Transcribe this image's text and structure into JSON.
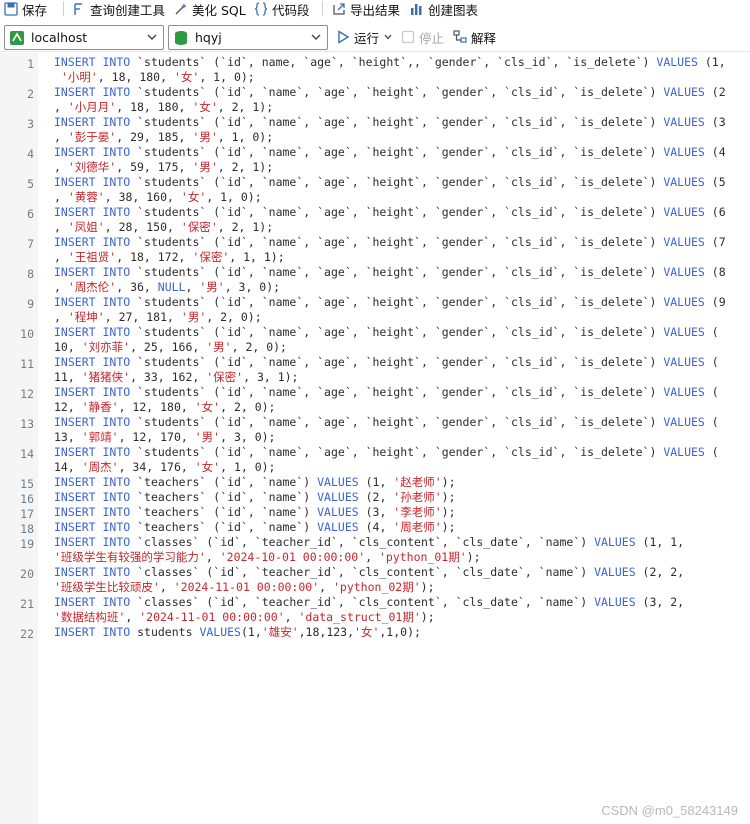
{
  "toolbar": {
    "save_label": "保存",
    "query_builder_label": "查询创建工具",
    "beautify_label": "美化 SQL",
    "snippet_label": "代码段",
    "export_label": "导出结果",
    "chart_label": "创建图表"
  },
  "connection": {
    "value": "localhost"
  },
  "database": {
    "value": "hqyj"
  },
  "actions": {
    "run_label": "运行",
    "stop_label": "停止",
    "explain_label": "解释"
  },
  "editor": {
    "lines": [
      {
        "n": "1",
        "a": "INSERT INTO `students` (`id`, name, `age`, `height`,, `gender`, `cls_id`, `is_delete`) VALUES (1,",
        "b": " '小明', 18, 180, '女', 1, 0);"
      },
      {
        "n": "2",
        "a": "INSERT INTO `students` (`id`, `name`, `age`, `height`, `gender`, `cls_id`, `is_delete`) VALUES (2",
        "b": ", '小月月', 18, 180, '女', 2, 1);"
      },
      {
        "n": "3",
        "a": "INSERT INTO `students` (`id`, `name`, `age`, `height`, `gender`, `cls_id`, `is_delete`) VALUES (3",
        "b": ", '彭于晏', 29, 185, '男', 1, 0);"
      },
      {
        "n": "4",
        "a": "INSERT INTO `students` (`id`, `name`, `age`, `height`, `gender`, `cls_id`, `is_delete`) VALUES (4",
        "b": ", '刘德华', 59, 175, '男', 2, 1);"
      },
      {
        "n": "5",
        "a": "INSERT INTO `students` (`id`, `name`, `age`, `height`, `gender`, `cls_id`, `is_delete`) VALUES (5",
        "b": ", '黄蓉', 38, 160, '女', 1, 0);"
      },
      {
        "n": "6",
        "a": "INSERT INTO `students` (`id`, `name`, `age`, `height`, `gender`, `cls_id`, `is_delete`) VALUES (6",
        "b": ", '凤姐', 28, 150, '保密', 2, 1);"
      },
      {
        "n": "7",
        "a": "INSERT INTO `students` (`id`, `name`, `age`, `height`, `gender`, `cls_id`, `is_delete`) VALUES (7",
        "b": ", '王祖贤', 18, 172, '保密', 1, 1);"
      },
      {
        "n": "8",
        "a": "INSERT INTO `students` (`id`, `name`, `age`, `height`, `gender`, `cls_id`, `is_delete`) VALUES (8",
        "b": ", '周杰伦', 36, NULL, '男', 3, 0);"
      },
      {
        "n": "9",
        "a": "INSERT INTO `students` (`id`, `name`, `age`, `height`, `gender`, `cls_id`, `is_delete`) VALUES (9",
        "b": ", '程坤', 27, 181, '男', 2, 0);"
      },
      {
        "n": "10",
        "a": "INSERT INTO `students` (`id`, `name`, `age`, `height`, `gender`, `cls_id`, `is_delete`) VALUES (",
        "b": "10, '刘亦菲', 25, 166, '男', 2, 0);"
      },
      {
        "n": "11",
        "a": "INSERT INTO `students` (`id`, `name`, `age`, `height`, `gender`, `cls_id`, `is_delete`) VALUES (",
        "b": "11, '猪猪侠', 33, 162, '保密', 3, 1);"
      },
      {
        "n": "12",
        "a": "INSERT INTO `students` (`id`, `name`, `age`, `height`, `gender`, `cls_id`, `is_delete`) VALUES (",
        "b": "12, '静香', 12, 180, '女', 2, 0);"
      },
      {
        "n": "13",
        "a": "INSERT INTO `students` (`id`, `name`, `age`, `height`, `gender`, `cls_id`, `is_delete`) VALUES (",
        "b": "13, '郭靖', 12, 170, '男', 3, 0);"
      },
      {
        "n": "14",
        "a": "INSERT INTO `students` (`id`, `name`, `age`, `height`, `gender`, `cls_id`, `is_delete`) VALUES (",
        "b": "14, '周杰', 34, 176, '女', 1, 0);"
      },
      {
        "n": "15",
        "a": "INSERT INTO `teachers` (`id`, `name`) VALUES (1, '赵老师');"
      },
      {
        "n": "16",
        "a": "INSERT INTO `teachers` (`id`, `name`) VALUES (2, '孙老师');"
      },
      {
        "n": "17",
        "a": "INSERT INTO `teachers` (`id`, `name`) VALUES (3, '李老师');"
      },
      {
        "n": "18",
        "a": "INSERT INTO `teachers` (`id`, `name`) VALUES (4, '周老师');"
      },
      {
        "n": "19",
        "a": "INSERT INTO `classes` (`id`, `teacher_id`, `cls_content`, `cls_date`, `name`) VALUES (1, 1,",
        "b": "'班级学生有较强的学习能力', '2024-10-01 00:00:00', 'python_01期');"
      },
      {
        "n": "20",
        "a": "INSERT INTO `classes` (`id`, `teacher_id`, `cls_content`, `cls_date`, `name`) VALUES (2, 2,",
        "b": "'班级学生比较顽皮', '2024-11-01 00:00:00', 'python_02期');"
      },
      {
        "n": "21",
        "a": "INSERT INTO `classes` (`id`, `teacher_id`, `cls_content`, `cls_date`, `name`) VALUES (3, 2,",
        "b": "'数据结构班', '2024-11-01 00:00:00', 'data_struct_01期');"
      },
      {
        "n": "22",
        "a": "INSERT INTO students VALUES(1,'雄安',18,123,'女',1,0);"
      }
    ]
  },
  "watermark": "CSDN @m0_58243149",
  "colors": {
    "keyword": "#3b63d6",
    "string": "#c5262c",
    "line_number": "#6b7f8e",
    "gutter_bg": "#f5f5f5"
  }
}
